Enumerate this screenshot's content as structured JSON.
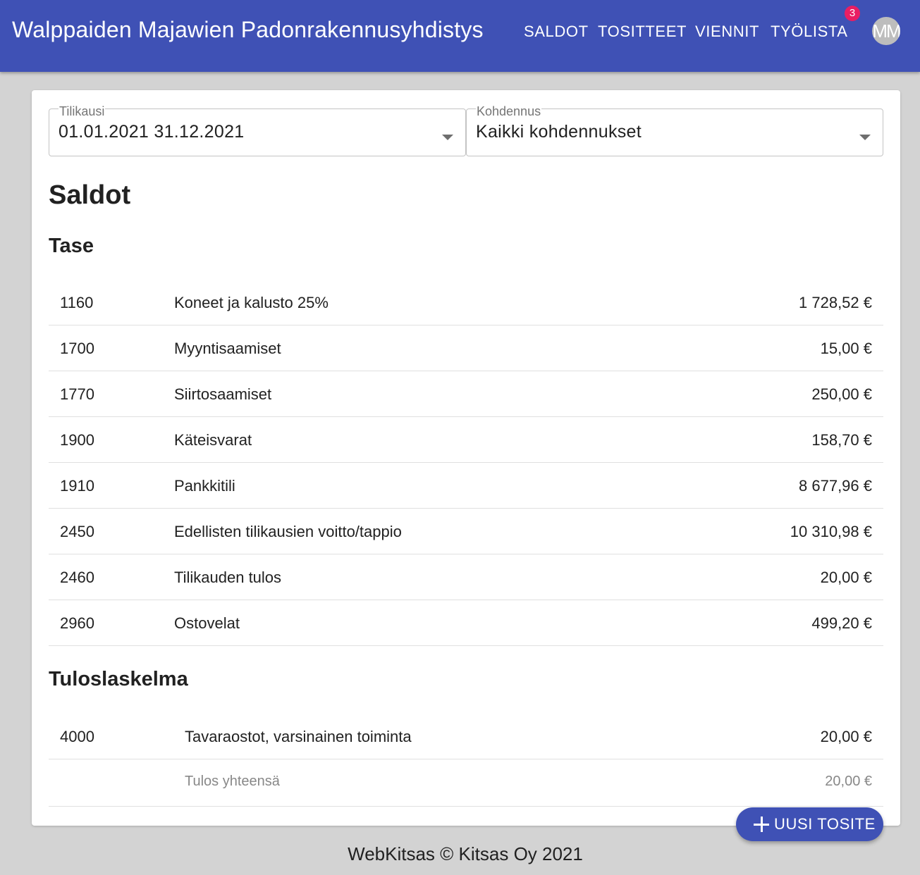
{
  "header": {
    "title": "Walppaiden Majawien Padonrakennusyhdistys",
    "nav": [
      "SALDOT",
      "TOSITTEET",
      "VIENNIT",
      "TYÖLISTA"
    ],
    "worklist_badge": "3",
    "avatar_initials": "MM",
    "colors": {
      "appbar": "#3f51b5",
      "badge": "#e91e63"
    }
  },
  "filters": {
    "period": {
      "label": "Tilikausi",
      "value": "01.01.2021 31.12.2021"
    },
    "allocation": {
      "label": "Kohdennus",
      "value": "Kaikki kohdennukset"
    }
  },
  "page_title": "Saldot",
  "balance": {
    "title": "Tase",
    "rows": [
      {
        "account": "1160",
        "name": "Koneet ja kalusto 25%",
        "amount": "1 728,52 €"
      },
      {
        "account": "1700",
        "name": "Myyntisaamiset",
        "amount": "15,00 €"
      },
      {
        "account": "1770",
        "name": "Siirtosaamiset",
        "amount": "250,00 €"
      },
      {
        "account": "1900",
        "name": "Käteisvarat",
        "amount": "158,70 €"
      },
      {
        "account": "1910",
        "name": "Pankkitili",
        "amount": "8 677,96 €"
      },
      {
        "account": "2450",
        "name": "Edellisten tilikausien voitto/tappio",
        "amount": "10 310,98 €"
      },
      {
        "account": "2460",
        "name": "Tilikauden tulos",
        "amount": "20,00 €"
      },
      {
        "account": "2960",
        "name": "Ostovelat",
        "amount": "499,20 €"
      }
    ]
  },
  "income": {
    "title": "Tuloslaskelma",
    "rows": [
      {
        "account": "4000",
        "name": "Tavaraostot, varsinainen toiminta",
        "amount": "20,00 €"
      }
    ],
    "total": {
      "label": "Tulos yhteensä",
      "amount": "20,00 €"
    }
  },
  "fab": {
    "label": "UUSI TOSITE",
    "icon": "plus-icon"
  },
  "footer": "WebKitsas © Kitsas Oy 2021"
}
